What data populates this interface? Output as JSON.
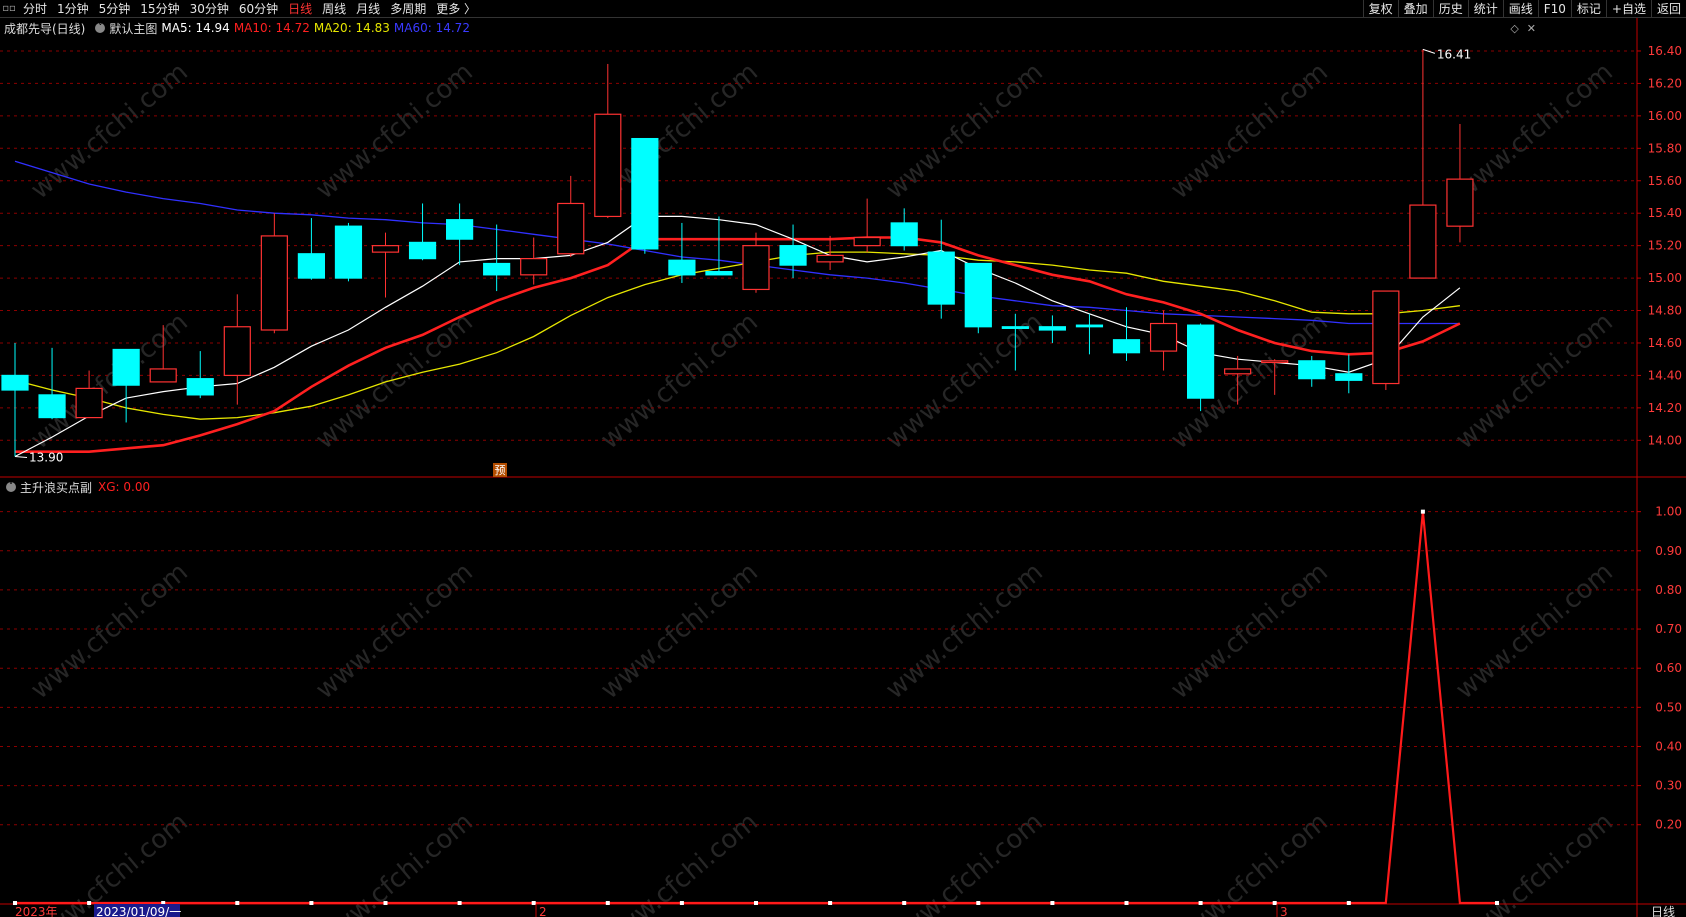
{
  "toolbar": {
    "corner_icon": "window-restore-icon",
    "periods": [
      "分时",
      "1分钟",
      "5分钟",
      "15分钟",
      "30分钟",
      "60分钟",
      "日线",
      "周线",
      "月线",
      "多周期",
      "更多 〉"
    ],
    "active_period": "日线",
    "right_items": [
      "复权",
      "叠加",
      "历史",
      "统计",
      "画线",
      "F10",
      "标记",
      "+自选",
      "返回"
    ]
  },
  "main_chart": {
    "stock_name": "成都先导(日线)",
    "template": "默认主图",
    "ma5_label": "MA5: 14.94",
    "ma10_label": "MA10: 14.72",
    "ma20_label": "MA20: 14.83",
    "ma60_label": "MA60: 14.72",
    "high_mark": "16.41",
    "low_mark": "13.90",
    "forecast_badge": "预",
    "y_ticks": [
      "16.40",
      "16.20",
      "16.00",
      "15.80",
      "15.60",
      "15.40",
      "15.20",
      "15.00",
      "14.80",
      "14.60",
      "14.40",
      "14.20",
      "14.00"
    ]
  },
  "sub_chart": {
    "indicator": "主升浪买点副",
    "xg_label": "XG: 0.00",
    "y_ticks": [
      "1.00",
      "0.90",
      "0.80",
      "0.70",
      "0.60",
      "0.50",
      "0.40",
      "0.30",
      "0.20"
    ]
  },
  "x_axis": {
    "year_label": "2023年",
    "cursor_date": "2023/01/09/一",
    "month2": "2",
    "month3": "3",
    "period_label": "日线"
  },
  "watermark": "www.cfchi.com",
  "colors": {
    "up": "#ff3232",
    "down": "#00ffff",
    "ma5": "#ffffff",
    "ma10": "#ff2020",
    "ma20": "#e6e600",
    "ma60": "#3030ff",
    "grid": "#8b0000",
    "axis": "#c00000"
  },
  "chart_data": {
    "type": "candlestick",
    "candles": [
      {
        "o": 14.4,
        "c": 14.31,
        "h": 14.6,
        "l": 13.9
      },
      {
        "o": 14.28,
        "c": 14.14,
        "h": 14.57,
        "l": 14.13
      },
      {
        "o": 14.14,
        "c": 14.32,
        "h": 14.43,
        "l": 14.14
      },
      {
        "o": 14.56,
        "c": 14.34,
        "h": 14.56,
        "l": 14.11
      },
      {
        "o": 14.36,
        "c": 14.44,
        "h": 14.71,
        "l": 14.36
      },
      {
        "o": 14.38,
        "c": 14.28,
        "h": 14.55,
        "l": 14.26
      },
      {
        "o": 14.4,
        "c": 14.7,
        "h": 14.9,
        "l": 14.22
      },
      {
        "o": 14.68,
        "c": 15.26,
        "h": 15.4,
        "l": 14.66
      },
      {
        "o": 15.15,
        "c": 15.0,
        "h": 15.37,
        "l": 14.99
      },
      {
        "o": 15.32,
        "c": 15.0,
        "h": 15.34,
        "l": 14.98
      },
      {
        "o": 15.16,
        "c": 15.2,
        "h": 15.28,
        "l": 14.88
      },
      {
        "o": 15.22,
        "c": 15.12,
        "h": 15.46,
        "l": 15.11
      },
      {
        "o": 15.36,
        "c": 15.24,
        "h": 15.46,
        "l": 15.08
      },
      {
        "o": 15.09,
        "c": 15.02,
        "h": 15.33,
        "l": 14.92
      },
      {
        "o": 15.02,
        "c": 15.12,
        "h": 15.25,
        "l": 14.96
      },
      {
        "o": 15.15,
        "c": 15.46,
        "h": 15.63,
        "l": 15.13
      },
      {
        "o": 15.38,
        "c": 16.01,
        "h": 16.32,
        "l": 15.37
      },
      {
        "o": 15.86,
        "c": 15.18,
        "h": 15.86,
        "l": 15.15
      },
      {
        "o": 15.11,
        "c": 15.02,
        "h": 15.34,
        "l": 14.97
      },
      {
        "o": 15.04,
        "c": 15.02,
        "h": 15.38,
        "l": 15.02
      },
      {
        "o": 14.93,
        "c": 15.2,
        "h": 15.28,
        "l": 14.91
      },
      {
        "o": 15.2,
        "c": 15.08,
        "h": 15.33,
        "l": 15.0
      },
      {
        "o": 15.1,
        "c": 15.14,
        "h": 15.26,
        "l": 15.05
      },
      {
        "o": 15.2,
        "c": 15.25,
        "h": 15.49,
        "l": 15.16
      },
      {
        "o": 15.34,
        "c": 15.2,
        "h": 15.43,
        "l": 15.17
      },
      {
        "o": 15.16,
        "c": 14.84,
        "h": 15.36,
        "l": 14.75
      },
      {
        "o": 15.09,
        "c": 14.7,
        "h": 15.09,
        "l": 14.66
      },
      {
        "o": 14.7,
        "c": 14.69,
        "h": 14.78,
        "l": 14.43
      },
      {
        "o": 14.7,
        "c": 14.68,
        "h": 14.77,
        "l": 14.6
      },
      {
        "o": 14.71,
        "c": 14.7,
        "h": 14.78,
        "l": 14.53
      },
      {
        "o": 14.62,
        "c": 14.54,
        "h": 14.82,
        "l": 14.49
      },
      {
        "o": 14.55,
        "c": 14.72,
        "h": 14.8,
        "l": 14.43
      },
      {
        "o": 14.71,
        "c": 14.26,
        "h": 14.72,
        "l": 14.18
      },
      {
        "o": 14.41,
        "c": 14.44,
        "h": 14.52,
        "l": 14.22
      },
      {
        "o": 14.48,
        "c": 14.49,
        "h": 14.5,
        "l": 14.28
      },
      {
        "o": 14.49,
        "c": 14.38,
        "h": 14.52,
        "l": 14.33
      },
      {
        "o": 14.41,
        "c": 14.37,
        "h": 14.53,
        "l": 14.29
      },
      {
        "o": 14.35,
        "c": 14.92,
        "h": 14.92,
        "l": 14.31
      },
      {
        "o": 15.0,
        "c": 15.45,
        "h": 16.41,
        "l": 15.0
      },
      {
        "o": 15.32,
        "c": 15.61,
        "h": 15.95,
        "l": 15.22
      }
    ],
    "ma5": [
      13.9,
      14.02,
      14.15,
      14.26,
      14.3,
      14.33,
      14.35,
      14.45,
      14.58,
      14.68,
      14.82,
      14.95,
      15.1,
      15.12,
      15.12,
      15.14,
      15.22,
      15.38,
      15.38,
      15.36,
      15.33,
      15.24,
      15.14,
      15.1,
      15.13,
      15.17,
      15.06,
      14.97,
      14.86,
      14.78,
      14.7,
      14.65,
      14.54,
      14.5,
      14.48,
      14.46,
      14.42,
      14.5,
      14.76,
      14.94
    ],
    "ma10": [
      13.93,
      13.93,
      13.93,
      13.95,
      13.97,
      14.03,
      14.1,
      14.18,
      14.33,
      14.46,
      14.57,
      14.65,
      14.76,
      14.86,
      14.94,
      15.0,
      15.08,
      15.24,
      15.24,
      15.24,
      15.24,
      15.24,
      15.24,
      15.25,
      15.25,
      15.22,
      15.14,
      15.08,
      15.02,
      14.98,
      14.9,
      14.85,
      14.78,
      14.68,
      14.6,
      14.55,
      14.53,
      14.54,
      14.61,
      14.72
    ],
    "ma20": [
      14.37,
      14.31,
      14.26,
      14.2,
      14.16,
      14.13,
      14.14,
      14.17,
      14.21,
      14.28,
      14.36,
      14.42,
      14.47,
      14.54,
      14.64,
      14.77,
      14.88,
      14.96,
      15.02,
      15.06,
      15.1,
      15.14,
      15.16,
      15.16,
      15.15,
      15.14,
      15.11,
      15.1,
      15.08,
      15.05,
      15.03,
      14.98,
      14.95,
      14.92,
      14.86,
      14.79,
      14.78,
      14.78,
      14.8,
      14.83
    ],
    "ma60": [
      15.72,
      15.65,
      15.58,
      15.53,
      15.49,
      15.46,
      15.42,
      15.4,
      15.39,
      15.37,
      15.36,
      15.34,
      15.33,
      15.3,
      15.27,
      15.24,
      15.21,
      15.17,
      15.13,
      15.11,
      15.08,
      15.05,
      15.02,
      15.0,
      14.97,
      14.93,
      14.89,
      14.86,
      14.83,
      14.82,
      14.8,
      14.78,
      14.77,
      14.76,
      14.75,
      14.74,
      14.72,
      14.72,
      14.72,
      14.72
    ],
    "xg": [
      0,
      0,
      0,
      0,
      0,
      0,
      0,
      0,
      0,
      0,
      0,
      0,
      0,
      0,
      0,
      0,
      0,
      0,
      0,
      0,
      0,
      0,
      0,
      0,
      0,
      0,
      0,
      0,
      0,
      0,
      0,
      0,
      0,
      0,
      0,
      0,
      0,
      0,
      1,
      0,
      0
    ],
    "main_ylim": [
      13.78,
      16.48
    ],
    "sub_ylim": [
      0,
      1.04
    ]
  }
}
